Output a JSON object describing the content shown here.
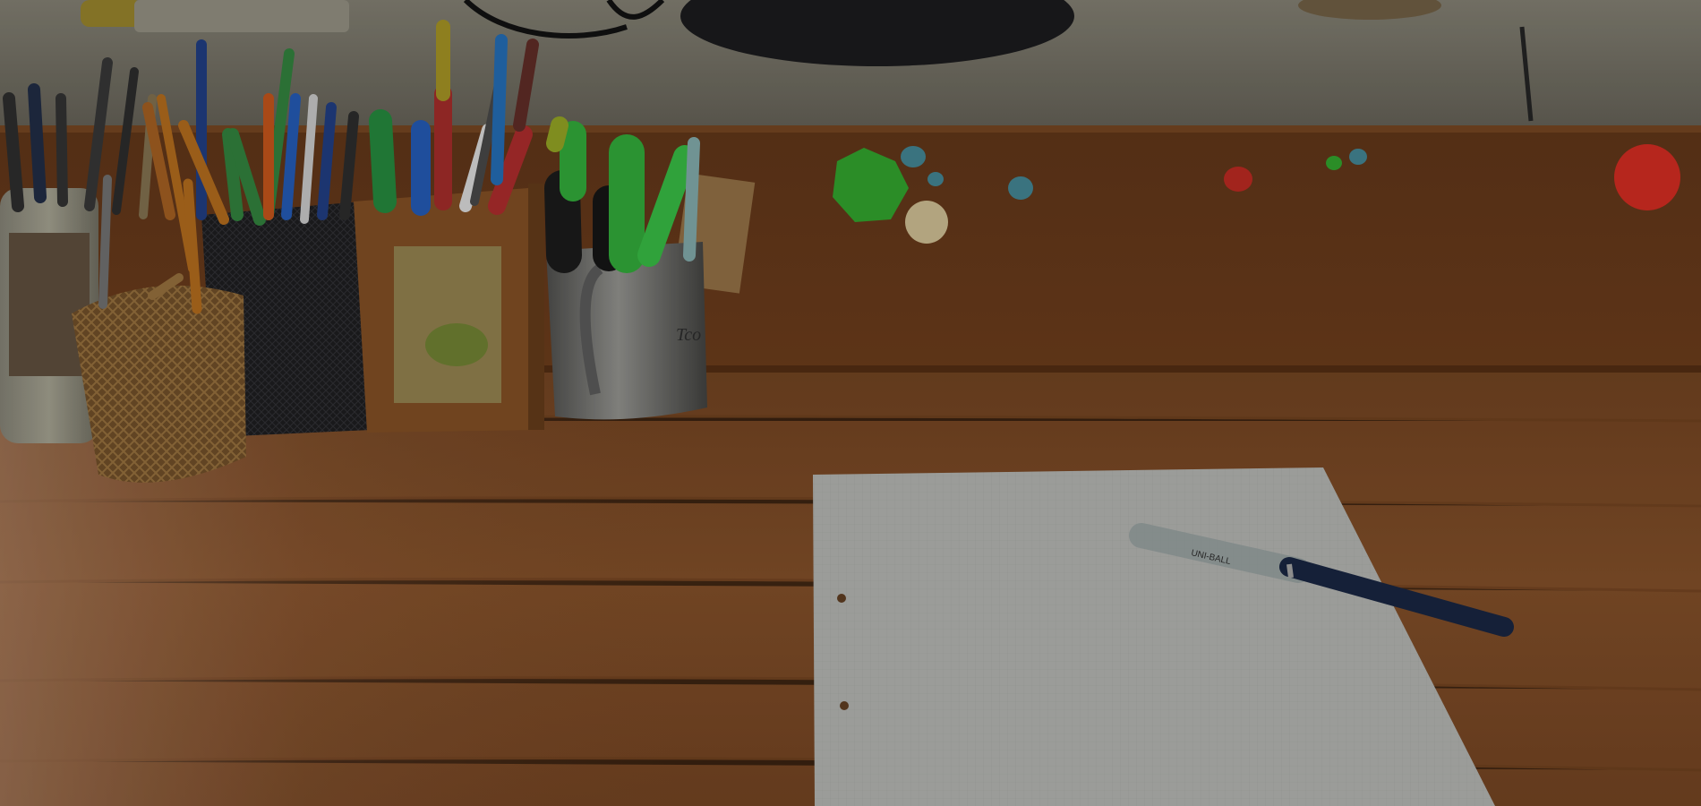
{
  "scene": {
    "description_tags": [
      "desk",
      "pen-holders",
      "notepad",
      "pen",
      "fridge-magnets"
    ],
    "mug_print_text": "Tco",
    "pen_brand_text": "UNI-BALL"
  },
  "colors": {
    "desk_wood": "#7a4a26",
    "back_panel": "#5e3518",
    "windowsill": "#6e6a5c",
    "paper": "#a9aaa7",
    "pen_body": "#17233d",
    "magnet_red": "#c62a20",
    "magnet_green": "#2f9a2b"
  }
}
